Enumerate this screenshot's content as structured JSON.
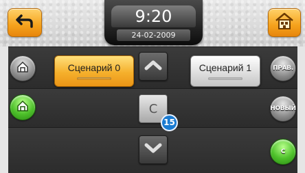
{
  "header": {
    "time": "9:20",
    "date": "24-02-2009"
  },
  "scenarios": {
    "active_label": "Сценарий 0",
    "inactive_label": "Сценарий 1"
  },
  "center": {
    "clear_label": "C",
    "badge": "15"
  },
  "right_buttons": {
    "edit_label": "ПРАВ.",
    "new_label": "НОВЫЙ",
    "clear_label": "C"
  },
  "colors": {
    "accent": "#f5a21c",
    "green": "#4ec12b",
    "badge": "#1a7bd1"
  }
}
